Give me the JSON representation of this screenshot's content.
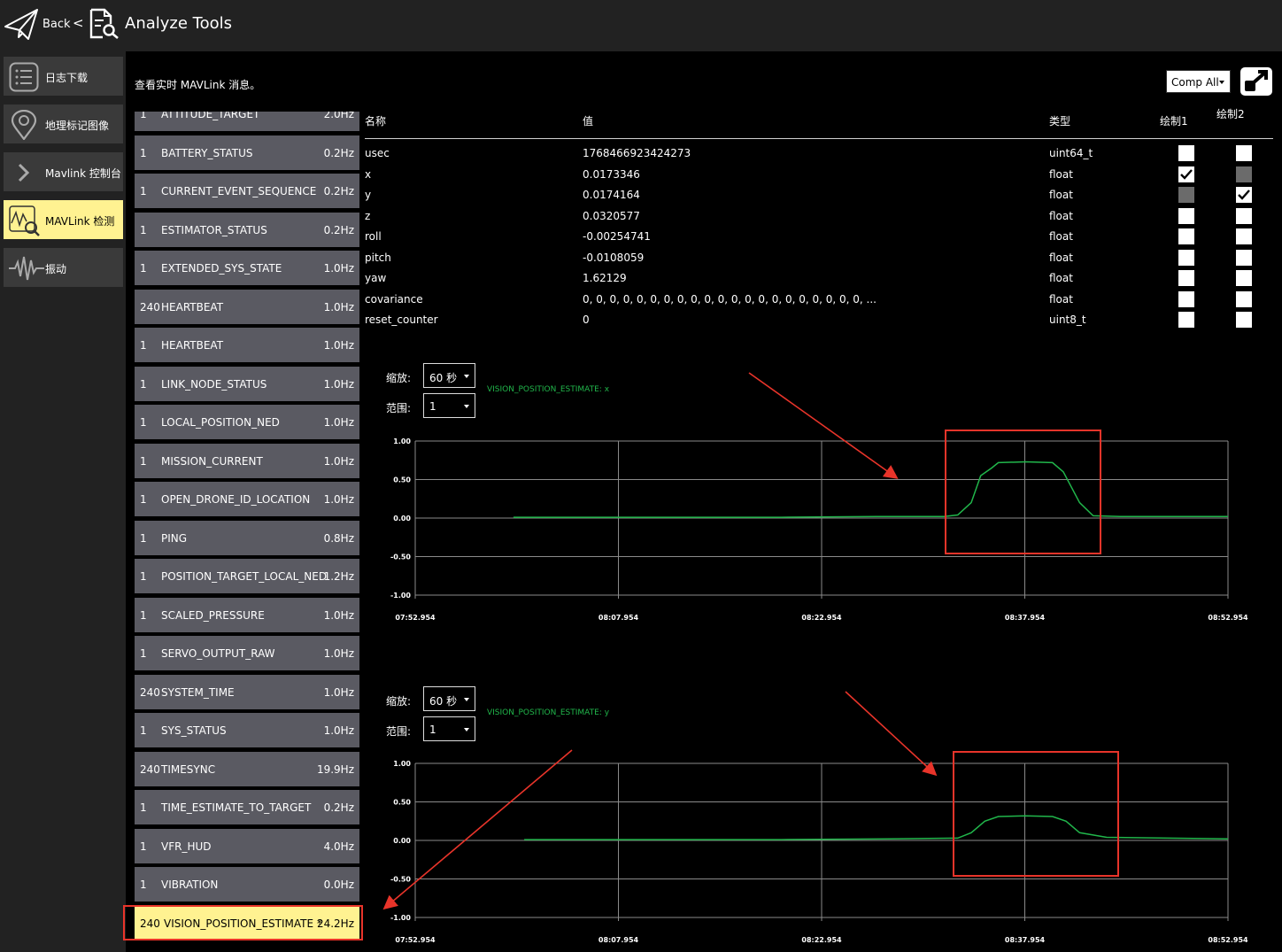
{
  "header": {
    "back_label": "Back",
    "separator": "<",
    "title": "Analyze Tools"
  },
  "sidebar": {
    "items": [
      {
        "label": "日志下载",
        "icon": "list-icon",
        "active": false
      },
      {
        "label": "地理标记图像",
        "icon": "map-pin-icon",
        "active": false
      },
      {
        "label": "Mavlink 控制台",
        "icon": "chevron-right-icon",
        "active": false
      },
      {
        "label": "MAVLink 检测",
        "icon": "chart-search-icon",
        "active": true
      },
      {
        "label": "振动",
        "icon": "waveform-icon",
        "active": false
      }
    ]
  },
  "main": {
    "description": "查看实时 MAVLink 消息。",
    "comp_select": "Comp All"
  },
  "messages": [
    {
      "count": "1",
      "name": "ATTITUDE_TARGET",
      "hz": "2.0Hz"
    },
    {
      "count": "1",
      "name": "BATTERY_STATUS",
      "hz": "0.2Hz"
    },
    {
      "count": "1",
      "name": "CURRENT_EVENT_SEQUENCE",
      "hz": "0.2Hz"
    },
    {
      "count": "1",
      "name": "ESTIMATOR_STATUS",
      "hz": "0.2Hz"
    },
    {
      "count": "1",
      "name": "EXTENDED_SYS_STATE",
      "hz": "1.0Hz"
    },
    {
      "count": "240",
      "name": "HEARTBEAT",
      "hz": "1.0Hz"
    },
    {
      "count": "1",
      "name": "HEARTBEAT",
      "hz": "1.0Hz"
    },
    {
      "count": "1",
      "name": "LINK_NODE_STATUS",
      "hz": "1.0Hz"
    },
    {
      "count": "1",
      "name": "LOCAL_POSITION_NED",
      "hz": "1.0Hz"
    },
    {
      "count": "1",
      "name": "MISSION_CURRENT",
      "hz": "1.0Hz"
    },
    {
      "count": "1",
      "name": "OPEN_DRONE_ID_LOCATION",
      "hz": "1.0Hz"
    },
    {
      "count": "1",
      "name": "PING",
      "hz": "0.8Hz"
    },
    {
      "count": "1",
      "name": "POSITION_TARGET_LOCAL_NED",
      "hz": "1.2Hz"
    },
    {
      "count": "1",
      "name": "SCALED_PRESSURE",
      "hz": "1.0Hz"
    },
    {
      "count": "1",
      "name": "SERVO_OUTPUT_RAW",
      "hz": "1.0Hz"
    },
    {
      "count": "240",
      "name": "SYSTEM_TIME",
      "hz": "1.0Hz"
    },
    {
      "count": "1",
      "name": "SYS_STATUS",
      "hz": "1.0Hz"
    },
    {
      "count": "240",
      "name": "TIMESYNC",
      "hz": "19.9Hz"
    },
    {
      "count": "1",
      "name": "TIME_ESTIMATE_TO_TARGET",
      "hz": "0.2Hz"
    },
    {
      "count": "1",
      "name": "VFR_HUD",
      "hz": "4.0Hz"
    },
    {
      "count": "1",
      "name": "VIBRATION",
      "hz": "0.0Hz"
    },
    {
      "count": "240",
      "name": "VISION_POSITION_ESTIMATE *",
      "hz": "24.2Hz",
      "selected": true
    }
  ],
  "fields": {
    "headers": {
      "name": "名称",
      "value": "值",
      "type": "类型",
      "plot1": "绘制1",
      "plot2": "绘制2"
    },
    "rows": [
      {
        "name": "usec",
        "value": "1768466923424273",
        "type": "uint64_t",
        "plot1": "unchecked",
        "plot2": "unchecked"
      },
      {
        "name": "x",
        "value": "0.0173346",
        "type": "float",
        "plot1": "checked",
        "plot2": "disabled"
      },
      {
        "name": "y",
        "value": "0.0174164",
        "type": "float",
        "plot1": "disabled",
        "plot2": "checked"
      },
      {
        "name": "z",
        "value": "0.0320577",
        "type": "float",
        "plot1": "unchecked",
        "plot2": "unchecked"
      },
      {
        "name": "roll",
        "value": "-0.00254741",
        "type": "float",
        "plot1": "unchecked",
        "plot2": "unchecked"
      },
      {
        "name": "pitch",
        "value": "-0.0108059",
        "type": "float",
        "plot1": "unchecked",
        "plot2": "unchecked"
      },
      {
        "name": "yaw",
        "value": "1.62129",
        "type": "float",
        "plot1": "unchecked",
        "plot2": "unchecked"
      },
      {
        "name": "covariance",
        "value": "0, 0, 0, 0, 0, 0, 0, 0, 0, 0, 0, 0, 0, 0, 0, 0, 0, 0, 0, 0, 0, ...",
        "type": "float",
        "plot1": "unchecked",
        "plot2": "unchecked"
      },
      {
        "name": "reset_counter",
        "value": "0",
        "type": "uint8_t",
        "plot1": "unchecked",
        "plot2": "unchecked"
      }
    ]
  },
  "plots": [
    {
      "scale_label": "缩放:",
      "scale_value": "60 秒",
      "range_label": "范围:",
      "range_value": "1"
    },
    {
      "scale_label": "缩放:",
      "scale_value": "60 秒",
      "range_label": "范围:",
      "range_value": "1"
    }
  ],
  "colors": {
    "series": "#21b64b",
    "highlight": "#fff291",
    "annotation": "#e8342a",
    "list_item": "#5a5a62"
  },
  "chart_data": [
    {
      "type": "line",
      "series": [
        {
          "name": "VISION_POSITION_ESTIMATE: x",
          "x": [
            "08:00.2",
            "08:10",
            "08:20",
            "08:27",
            "08:32",
            "08:33",
            "08:34",
            "08:34.7",
            "08:35.5",
            "08:36",
            "08:38",
            "08:40",
            "08:40.8",
            "08:42",
            "08:43",
            "08:45",
            "08:52.954"
          ],
          "y": [
            0.01,
            0.01,
            0.01,
            0.02,
            0.02,
            0.04,
            0.2,
            0.55,
            0.65,
            0.72,
            0.73,
            0.72,
            0.6,
            0.2,
            0.03,
            0.02,
            0.02
          ]
        }
      ],
      "x_tick_labels": [
        "07:52.954",
        "08:07.954",
        "08:22.954",
        "08:37.954",
        "08:52.954"
      ],
      "y_tick_labels": [
        "1.00",
        "0.50",
        "0.00",
        "-0.50",
        "-1.00"
      ],
      "ylim": [
        -1,
        1
      ],
      "grid": true
    },
    {
      "type": "line",
      "series": [
        {
          "name": "VISION_POSITION_ESTIMATE: y",
          "x": [
            "08:01",
            "08:10",
            "08:20",
            "08:28",
            "08:33",
            "08:34",
            "08:35",
            "08:36",
            "08:38",
            "08:40",
            "08:41",
            "08:42",
            "08:44",
            "08:52.954"
          ],
          "y": [
            0.01,
            0.01,
            0.01,
            0.02,
            0.03,
            0.1,
            0.25,
            0.31,
            0.32,
            0.31,
            0.25,
            0.1,
            0.04,
            0.02
          ]
        }
      ],
      "x_tick_labels": [
        "07:52.954",
        "08:07.954",
        "08:22.954",
        "08:37.954",
        "08:52.954"
      ],
      "y_tick_labels": [
        "1.00",
        "0.50",
        "0.00",
        "-0.50",
        "-1.00"
      ],
      "ylim": [
        -1,
        1
      ],
      "grid": true
    }
  ]
}
